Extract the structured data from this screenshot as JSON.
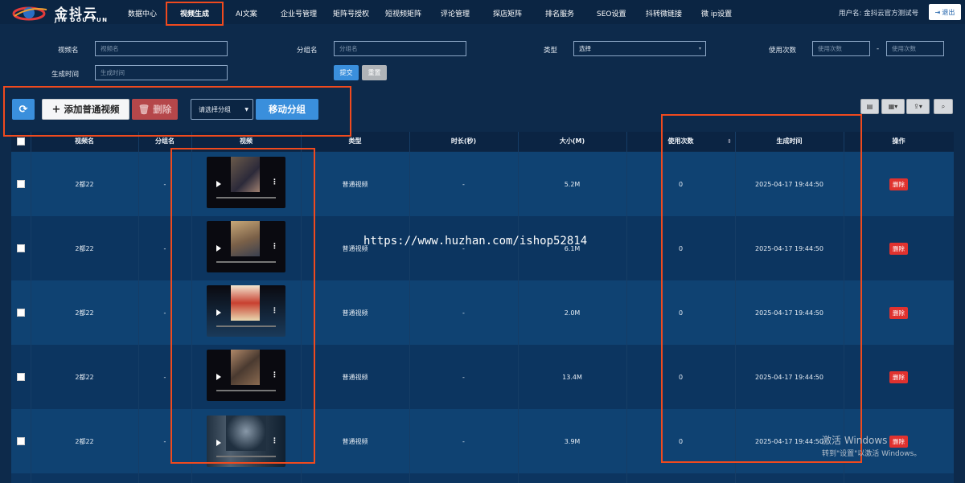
{
  "brand": {
    "name_cn": "金抖云",
    "name_en": "JIN DOU YUN"
  },
  "nav": {
    "items": [
      "数据中心",
      "视频生成",
      "AI文案",
      "企业号管理",
      "矩阵号授权",
      "短视频矩阵",
      "评论管理",
      "探店矩阵",
      "排名服务",
      "SEO设置",
      "抖转微链接",
      "微 ip设置"
    ],
    "active": "视频生成",
    "user_label": "用户名: 金抖云官方测试号",
    "logout": "退出"
  },
  "filters": {
    "video_name_label": "视频名",
    "video_name_placeholder": "视频名",
    "group_label": "分组名",
    "group_placeholder": "分组名",
    "type_label": "类型",
    "type_value": "选择",
    "uses_label": "使用次数",
    "uses_min_placeholder": "使用次数",
    "uses_sep": "-",
    "uses_max_placeholder": "使用次数",
    "time_label": "生成时间",
    "time_placeholder": "生成时间",
    "submit": "提交",
    "reset": "重置"
  },
  "actions": {
    "add": "添加普通视频",
    "delete": "删除",
    "group_select": "请选择分组",
    "move": "移动分组"
  },
  "table": {
    "headers": [
      "视频名",
      "分组名",
      "视频",
      "类型",
      "时长(秒)",
      "大小(M)",
      "使用次数",
      "生成时间",
      "操作"
    ],
    "rows": [
      {
        "name": "2都22",
        "group": "-",
        "type": "普通视频",
        "duration": "-",
        "size": "5.2M",
        "uses": "0",
        "time": "2025-04-17 19:44:50",
        "op": "删除"
      },
      {
        "name": "2都22",
        "group": "-",
        "type": "普通视频",
        "duration": "-",
        "size": "6.1M",
        "uses": "0",
        "time": "2025-04-17 19:44:50",
        "op": "删除"
      },
      {
        "name": "2都22",
        "group": "-",
        "type": "普通视频",
        "duration": "-",
        "size": "2.0M",
        "uses": "0",
        "time": "2025-04-17 19:44:50",
        "op": "删除"
      },
      {
        "name": "2都22",
        "group": "-",
        "type": "普通视频",
        "duration": "-",
        "size": "13.4M",
        "uses": "0",
        "time": "2025-04-17 19:44:50",
        "op": "删除"
      },
      {
        "name": "2都22",
        "group": "-",
        "type": "普通视频",
        "duration": "-",
        "size": "3.9M",
        "uses": "0",
        "time": "2025-04-17 19:44:50",
        "op": "删除"
      }
    ]
  },
  "watermark": "https://www.huzhan.com/ishop52814",
  "windows_activation": {
    "line1": "激活 Windows",
    "line2": "转到\"设置\"以激活 Windows。"
  },
  "colors": {
    "accent": "#3a8fdc",
    "danger": "#e0322f",
    "annotation": "#f04a1e"
  }
}
